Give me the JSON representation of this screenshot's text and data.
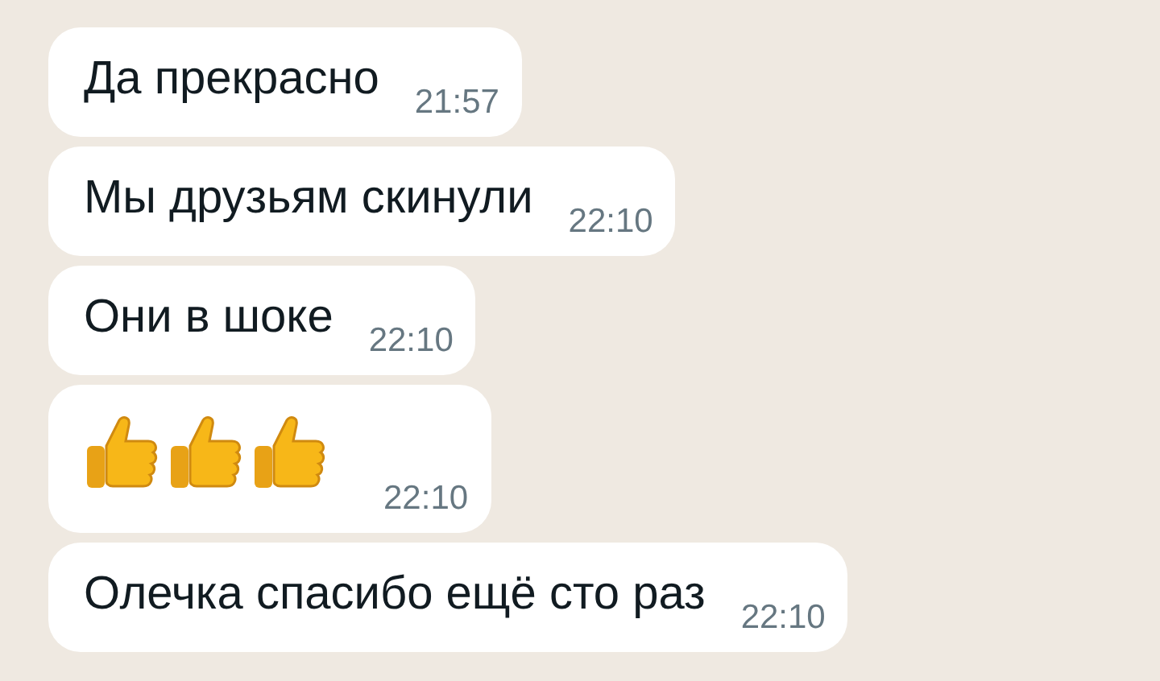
{
  "messages": [
    {
      "kind": "text",
      "text": "Да прекрасно",
      "time": "21:57"
    },
    {
      "kind": "text",
      "text": "Мы друзьям скинули",
      "time": "22:10"
    },
    {
      "kind": "text",
      "text": "Они в шоке",
      "time": "22:10"
    },
    {
      "kind": "thumbs",
      "time": "22:10"
    },
    {
      "kind": "text",
      "text": "Олечка спасибо ещё сто раз",
      "time": "22:10"
    }
  ]
}
